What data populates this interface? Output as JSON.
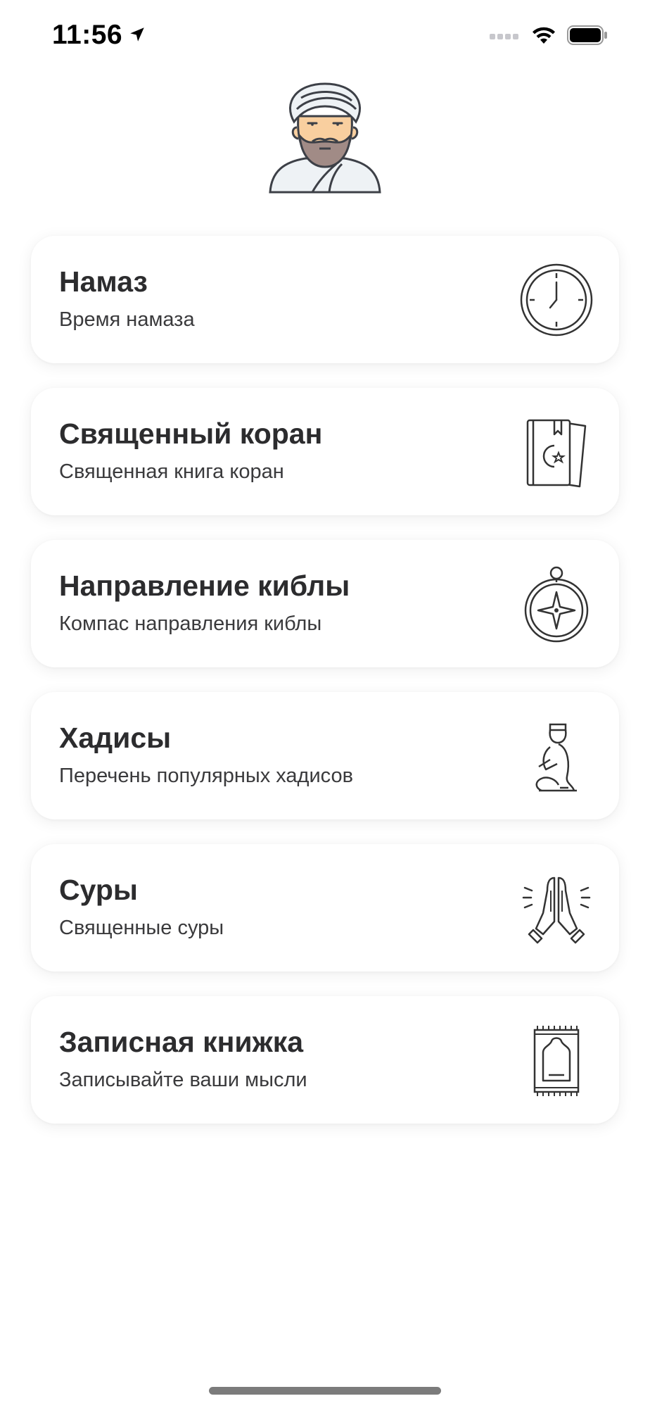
{
  "status_bar": {
    "time": "11:56",
    "icons": [
      "location-arrow-icon",
      "cellular-signal-icon",
      "wifi-icon",
      "battery-icon"
    ]
  },
  "header": {
    "avatar": "imam-avatar-icon"
  },
  "menu": {
    "items": [
      {
        "title": "Намаз",
        "subtitle": "Время намаза",
        "icon": "clock-icon"
      },
      {
        "title": "Священный коран",
        "subtitle": "Священная книга коран",
        "icon": "quran-book-icon"
      },
      {
        "title": "Направление киблы",
        "subtitle": "Компас направления киблы",
        "icon": "compass-icon"
      },
      {
        "title": "Хадисы",
        "subtitle": "Перечень популярных хадисов",
        "icon": "praying-man-icon"
      },
      {
        "title": "Суры",
        "subtitle": "Священные суры",
        "icon": "praying-hands-icon"
      },
      {
        "title": "Записная книжка",
        "subtitle": "Записывайте ваши мысли",
        "icon": "prayer-rug-icon"
      }
    ]
  },
  "colors": {
    "background": "#ffffff",
    "text_primary": "#2c2c2e",
    "icon_stroke": "#333333",
    "avatar_skin": "#f9cf9f",
    "avatar_beard": "#a18b86",
    "avatar_turban": "#eef2f5"
  }
}
